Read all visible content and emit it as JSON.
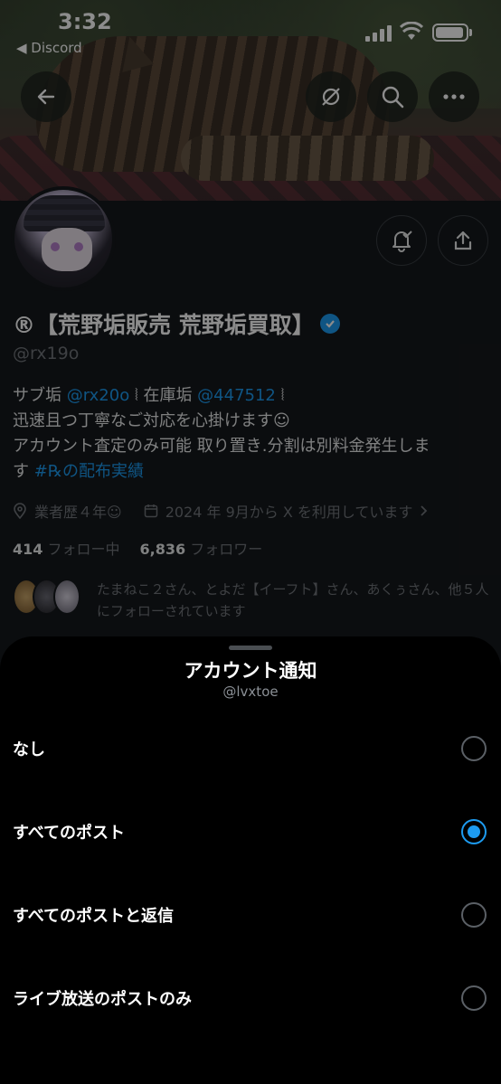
{
  "status_bar": {
    "time": "3:32",
    "back_app": "◀ Discord"
  },
  "profile": {
    "name": "®【荒野垢販売 荒野垢買取】",
    "verified": true,
    "handle": "@rx19o",
    "bio": {
      "line1_a": "サブ垢 ",
      "line1_link1": "@rx20o",
      "line1_b": " ⦚ 在庫垢 ",
      "line1_link2": "@447512",
      "line1_c": " ⦚",
      "line2": "迅速且つ丁寧なご対応を心掛けます☺︎",
      "line3": "アカウント査定のみ可能 取り置き.分割は別料金発生しま",
      "line4_a": "す ",
      "line4_link": "#℞の配布実績"
    },
    "experience": "業者歴４年☺︎",
    "joined": "2024 年 9月から X を利用しています",
    "following_count": "414",
    "following_label": "フォロー中",
    "followers_count": "6,836",
    "followers_label": "フォロワー",
    "followed_by": "たまねこ２さん、とよだ【イーフト】さん、あくぅさん、他５人にフォローされています"
  },
  "sheet": {
    "title": "アカウント通知",
    "subtitle": "@lvxtoe",
    "options": [
      {
        "label": "なし",
        "selected": false
      },
      {
        "label": "すべてのポスト",
        "selected": true
      },
      {
        "label": "すべてのポストと返信",
        "selected": false
      },
      {
        "label": "ライブ放送のポストのみ",
        "selected": false
      }
    ]
  },
  "colors": {
    "accent": "#1d9bf0",
    "sheet_bg": "#000000",
    "muted_text": "#71767b"
  },
  "icons": [
    "back-arrow-icon",
    "eye-slash-icon",
    "search-icon",
    "more-icon",
    "notification-bell-icon",
    "share-icon",
    "location-icon",
    "calendar-icon",
    "chevron-right-icon",
    "verified-badge-icon"
  ]
}
